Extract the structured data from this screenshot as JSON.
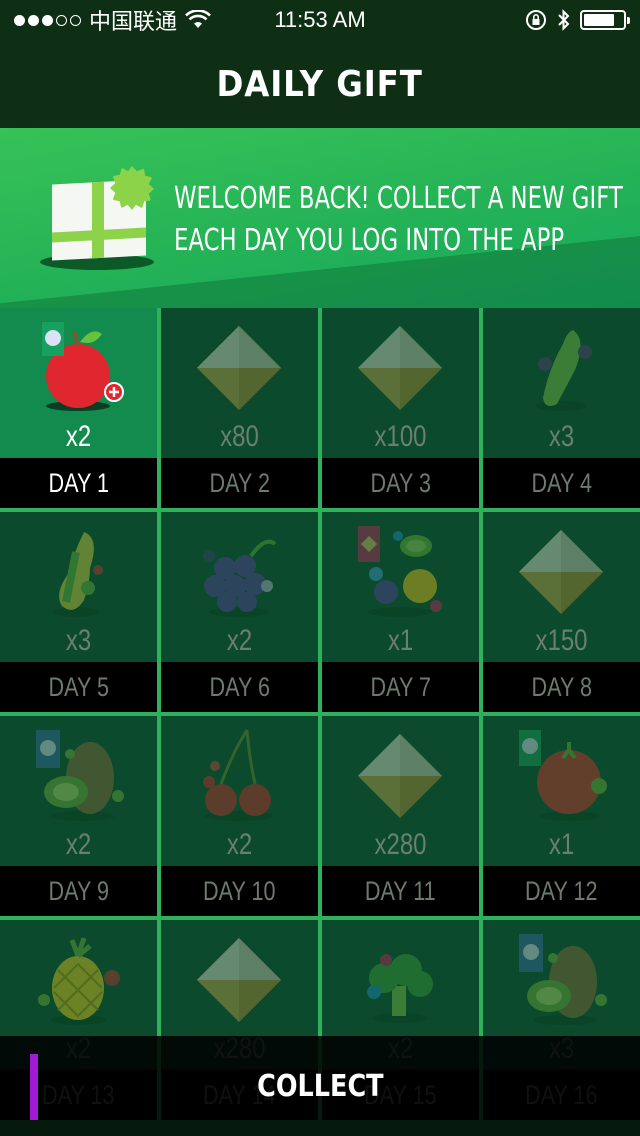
{
  "status_bar": {
    "carrier": "中国联通",
    "time": "11:53 AM",
    "signal_strength": "3 of 5",
    "icons": [
      "signal-dots-icon",
      "wifi-icon",
      "rotation-lock-icon",
      "bluetooth-icon",
      "battery-icon"
    ],
    "battery_level": 0.8
  },
  "header": {
    "title": "DAILY GIFT"
  },
  "banner": {
    "line1": "WELCOME BACK! COLLECT A NEW GIFT",
    "line2": "EACH DAY YOU LOG INTO THE APP",
    "icon": "gift-box-icon"
  },
  "days": [
    {
      "label": "DAY 1",
      "qty": "x2",
      "icon": "apple-icon",
      "active": true
    },
    {
      "label": "DAY 2",
      "qty": "x80",
      "icon": "gem-icon",
      "active": false
    },
    {
      "label": "DAY 3",
      "qty": "x100",
      "icon": "gem-icon",
      "active": false
    },
    {
      "label": "DAY 4",
      "qty": "x3",
      "icon": "cucumber-icon",
      "active": false
    },
    {
      "label": "DAY 5",
      "qty": "x3",
      "icon": "pear-icon",
      "active": false
    },
    {
      "label": "DAY 6",
      "qty": "x2",
      "icon": "grapes-icon",
      "active": false
    },
    {
      "label": "DAY 7",
      "qty": "x1",
      "icon": "fruit-mix-icon",
      "active": false
    },
    {
      "label": "DAY 8",
      "qty": "x150",
      "icon": "gem-icon",
      "active": false
    },
    {
      "label": "DAY 9",
      "qty": "x2",
      "icon": "kiwi-icon",
      "active": false
    },
    {
      "label": "DAY 10",
      "qty": "x2",
      "icon": "cherries-icon",
      "active": false
    },
    {
      "label": "DAY 11",
      "qty": "x280",
      "icon": "gem-icon",
      "active": false
    },
    {
      "label": "DAY 12",
      "qty": "x1",
      "icon": "tomato-icon",
      "active": false
    },
    {
      "label": "DAY 13",
      "qty": "x2",
      "icon": "pineapple-icon",
      "active": false
    },
    {
      "label": "DAY 14",
      "qty": "x280",
      "icon": "gem-icon",
      "active": false
    },
    {
      "label": "DAY 15",
      "qty": "x2",
      "icon": "broccoli-icon",
      "active": false
    },
    {
      "label": "DAY 16",
      "qty": "x3",
      "icon": "kiwi-icon",
      "active": false
    }
  ],
  "collect": {
    "label": "COLLECT"
  },
  "colors": {
    "header_bg": "#0f2f14",
    "banner_green": "#24b257",
    "grid_lines": "#2fb05a",
    "cell_bg": "#0b4a2c",
    "active_cell_bg": "#138b4f",
    "accent_purple": "#a11bd6"
  }
}
